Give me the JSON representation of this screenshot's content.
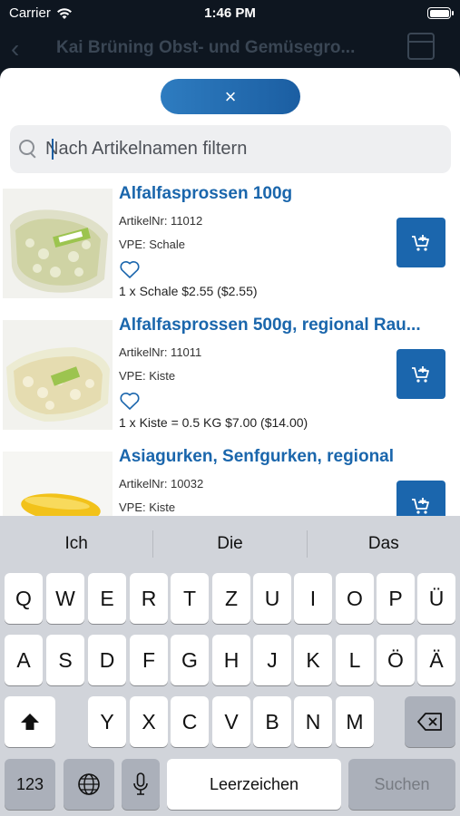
{
  "status_bar": {
    "carrier": "Carrier",
    "time": "1:46 PM"
  },
  "nav": {
    "title": "Kai Brüning Obst- und Gemüsegro..."
  },
  "sheet": {
    "close_label": "×",
    "search": {
      "placeholder": "Nach Artikelnamen filtern",
      "value": ""
    }
  },
  "products": [
    {
      "name": "Alfalfasprossen 100g",
      "article_no": "ArtikelNr: 11012",
      "vpe": "VPE: Schale",
      "price": "1 x Schale $2.55 ($2.55)",
      "favorite": false
    },
    {
      "name": "Alfalfasprossen 500g, regional Rau...",
      "article_no": "ArtikelNr: 11011",
      "vpe": "VPE: Kiste",
      "price": "1 x Kiste = 0.5 KG  $7.00 ($14.00)",
      "favorite": false
    },
    {
      "name": "Asiagurken, Senfgurken, regional",
      "article_no": "ArtikelNr: 10032",
      "vpe": "VPE: Kiste",
      "price": "",
      "favorite": false
    }
  ],
  "keyboard": {
    "suggestions": [
      "Ich",
      "Die",
      "Das"
    ],
    "row1": [
      "Q",
      "W",
      "E",
      "R",
      "T",
      "Z",
      "U",
      "I",
      "O",
      "P",
      "Ü"
    ],
    "row2": [
      "A",
      "S",
      "D",
      "F",
      "G",
      "H",
      "J",
      "K",
      "L",
      "Ö",
      "Ä"
    ],
    "row3": [
      "Y",
      "X",
      "C",
      "V",
      "B",
      "N",
      "M"
    ],
    "numbers_label": "123",
    "space_label": "Leerzeichen",
    "search_label": "Suchen"
  },
  "colors": {
    "accent": "#1b66ad",
    "title_blue": "#1a66ac",
    "keyboard_bg": "#d1d4da"
  }
}
